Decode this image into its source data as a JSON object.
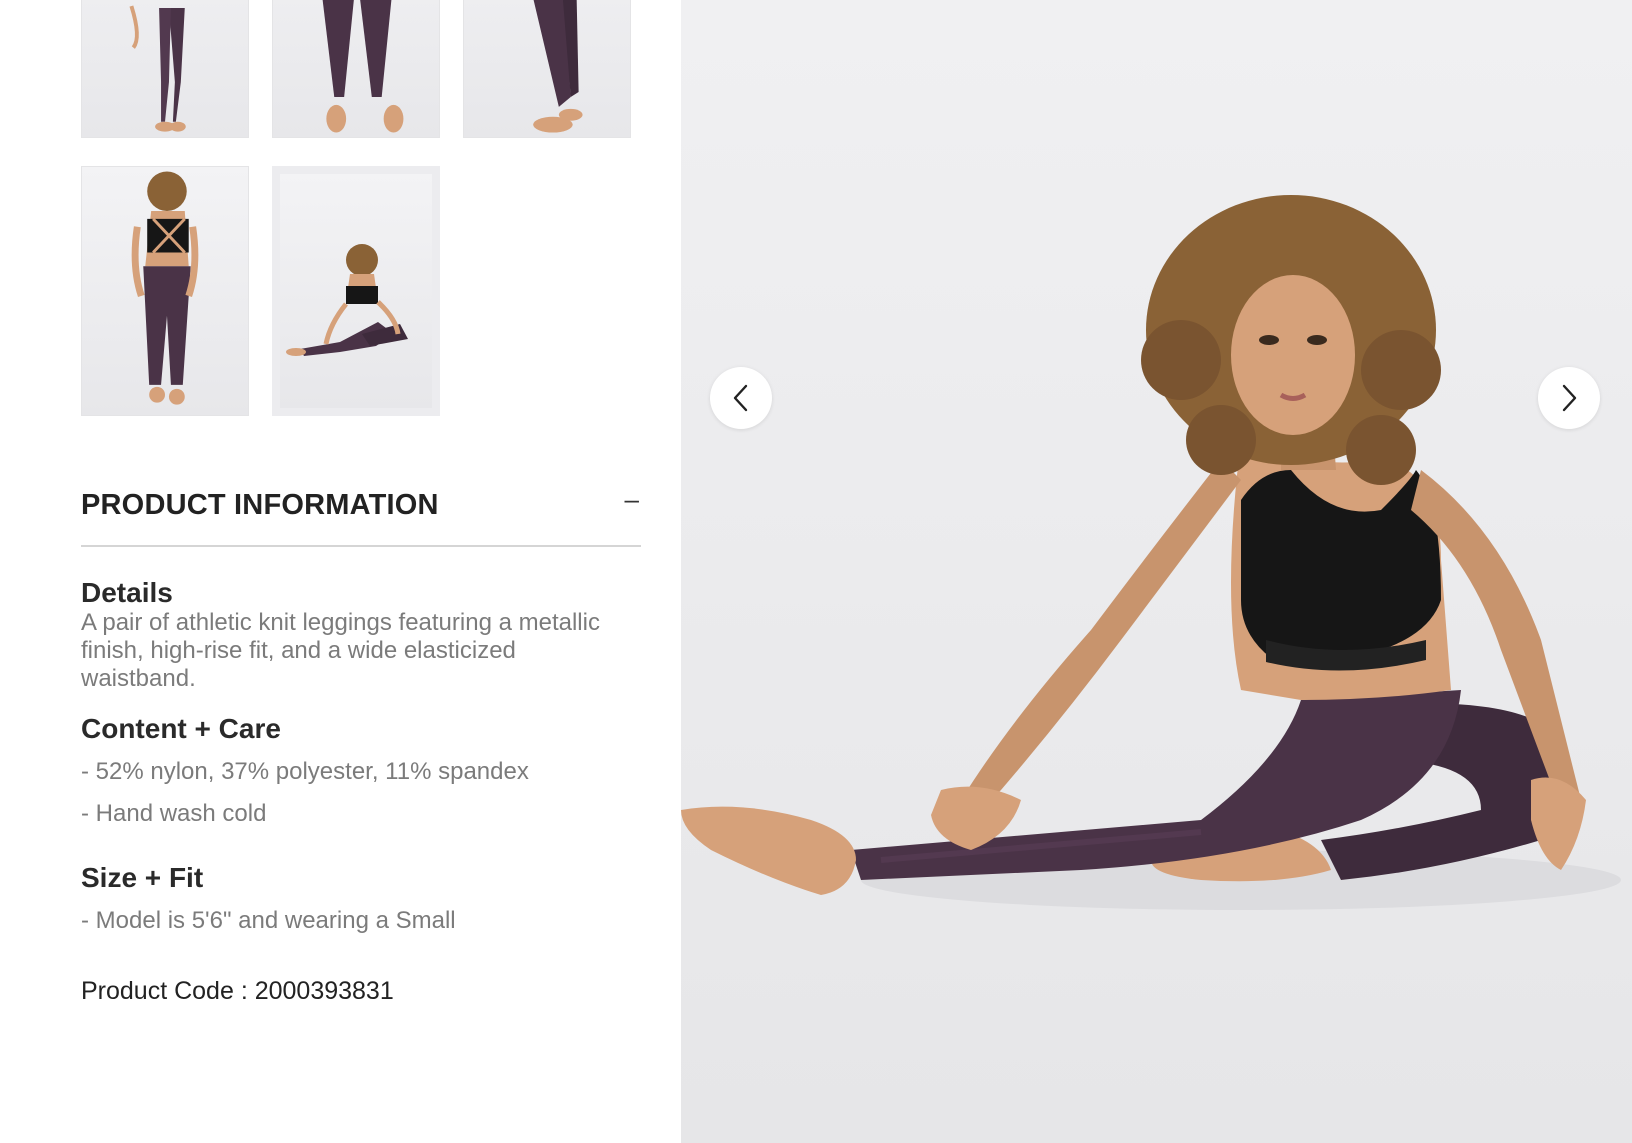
{
  "product_info": {
    "title": "PRODUCT INFORMATION",
    "toggle_symbol": "–",
    "details": {
      "heading": "Details",
      "text": "A pair of athletic knit leggings featuring a metallic finish, high-rise fit, and a wide elasticized waistband."
    },
    "content_care": {
      "heading": "Content + Care",
      "items": [
        "- 52% nylon, 37% polyester, 11% spandex",
        "- Hand wash cold"
      ]
    },
    "size_fit": {
      "heading": "Size + Fit",
      "items": [
        "- Model is 5'6\" and wearing a Small"
      ]
    },
    "product_code": "Product Code : 2000393831"
  },
  "gallery": {
    "thumbnails": [
      {
        "view": "front-full",
        "selected": false
      },
      {
        "view": "front-legs",
        "selected": false
      },
      {
        "view": "side-legs",
        "selected": false
      },
      {
        "view": "back-full",
        "selected": false
      },
      {
        "view": "seated-stretch",
        "selected": true
      }
    ],
    "prev_icon": "chevron-left-icon",
    "next_icon": "chevron-right-icon"
  },
  "colors": {
    "legging": "#4a3347",
    "top": "#161616",
    "skin": "#d6a17a",
    "hair": "#8a6236",
    "text_muted": "#7b7b7b",
    "divider": "#d5d5d5"
  }
}
